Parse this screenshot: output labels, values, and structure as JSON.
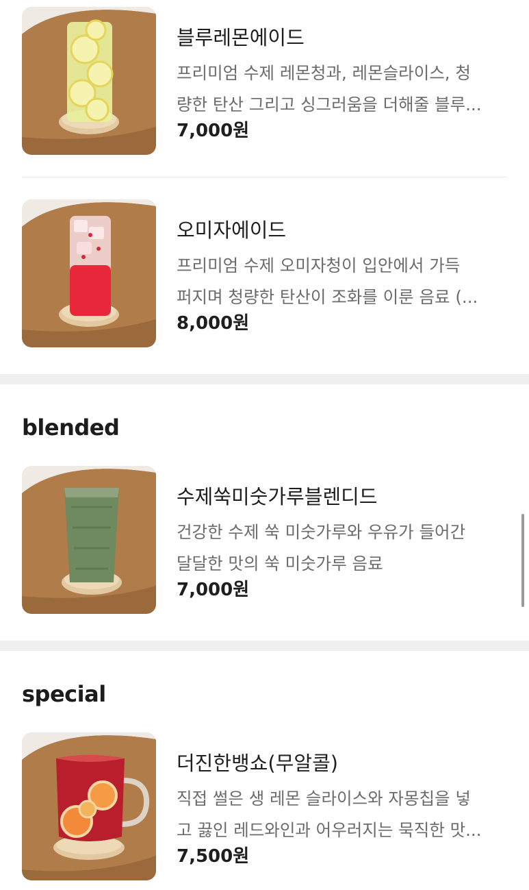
{
  "sections": [
    {
      "title": "",
      "items": [
        {
          "name": "블루레몬에이드",
          "desc_line1": "프리미엄 수제 레몬청과, 레몬슬라이스, 청",
          "desc_line2": "량한 탄산 그리고 싱그러움을 더해줄 블루...",
          "price": "7,000원",
          "image_icon": "lemonade-glass-icon"
        },
        {
          "name": "오미자에이드",
          "desc_line1": "프리미엄 수제 오미자청이 입안에서 가득",
          "desc_line2": "퍼지며 청량한 탄산이 조화를 이룬 음료 (...",
          "price": "8,000원",
          "image_icon": "omija-ade-glass-icon"
        }
      ]
    },
    {
      "title": "blended",
      "items": [
        {
          "name": "수제쑥미숫가루블렌디드",
          "desc_line1": "건강한 수제 쑥 미숫가루와 우유가 들어간",
          "desc_line2": "달달한 맛의 쑥 미숫가루 음료",
          "price": "7,000원",
          "image_icon": "mugwort-blended-glass-icon"
        }
      ]
    },
    {
      "title": "special",
      "items": [
        {
          "name": "더진한뱅쇼(무알콜)",
          "desc_line1": "직접 썰은 생 레몬 슬라이스와 자몽칩을 넣",
          "desc_line2": "고 끓인 레드와인과 어우러지는 묵직한 맛...",
          "price": "7,500원",
          "image_icon": "vin-chaud-mug-icon"
        }
      ]
    }
  ]
}
